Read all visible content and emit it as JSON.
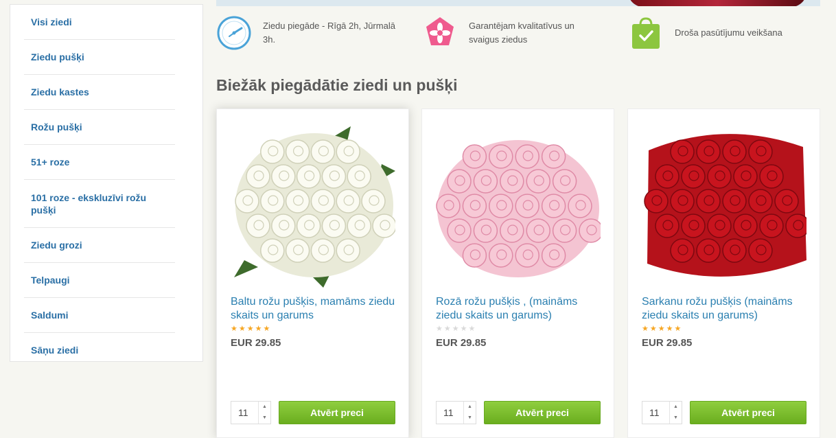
{
  "sidebar": {
    "items": [
      {
        "label": "Visi ziedi"
      },
      {
        "label": "Ziedu pušķi"
      },
      {
        "label": "Ziedu kastes"
      },
      {
        "label": "Rožu pušķi"
      },
      {
        "label": "51+ roze"
      },
      {
        "label": "101 roze - ekskluzīvi rožu pušķi"
      },
      {
        "label": "Ziedu grozi"
      },
      {
        "label": "Telpaugi"
      },
      {
        "label": "Saldumi"
      },
      {
        "label": "Sāņu ziedi"
      }
    ]
  },
  "features": [
    {
      "icon": "clock-icon",
      "text": "Ziedu piegāde - Rīgā 2h, Jūrmalā 3h."
    },
    {
      "icon": "flower-icon",
      "text": "Garantējam kvalitatīvus un svaigus ziedus"
    },
    {
      "icon": "shopping-bag-check-icon",
      "text": "Droša pasūtījumu veikšana"
    }
  ],
  "section": {
    "title": "Biežāk piegādātie ziedi un pušķi"
  },
  "colors": {
    "accent_blue": "#2a7fb0",
    "button_green": "#76b82a",
    "star_gold": "#f6a623",
    "star_empty": "#d9d9d9"
  },
  "products": [
    {
      "title": "Baltu rožu pušķis, mamāms ziedu skaits un garums",
      "rating": 5,
      "price": "EUR 29.85",
      "qty": "11",
      "button": "Atvērt preci",
      "image": "white-roses-bouquet"
    },
    {
      "title": "Rozā rožu pušķis , (maināms ziedu skaits un garums)",
      "rating": 0,
      "price": "EUR 29.85",
      "qty": "11",
      "button": "Atvērt preci",
      "image": "pink-roses-bouquet"
    },
    {
      "title": "Sarkanu rožu pušķis (maināms ziedu skaits un garums)",
      "rating": 5,
      "price": "EUR 29.85",
      "qty": "11",
      "button": "Atvērt preci",
      "image": "red-roses-bouquet"
    }
  ]
}
